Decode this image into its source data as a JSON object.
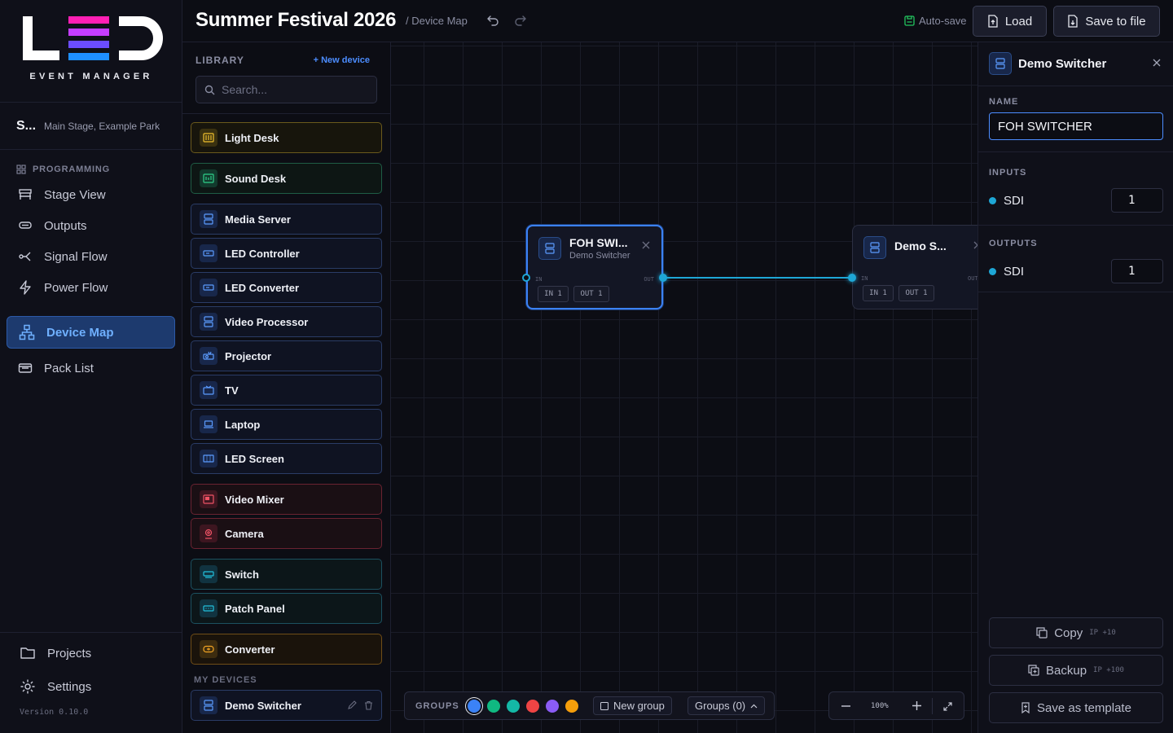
{
  "brand": {
    "logo_text": "LED",
    "subtitle": "EVENT MANAGER"
  },
  "project": {
    "name": "S...",
    "location": "Main Stage, Example Park"
  },
  "sidebar": {
    "section_label": "PROGRAMMING",
    "items": [
      {
        "label": "Stage View",
        "icon": "stage-icon"
      },
      {
        "label": "Outputs",
        "icon": "outputs-icon"
      },
      {
        "label": "Signal Flow",
        "icon": "signal-flow-icon"
      },
      {
        "label": "Power Flow",
        "icon": "power-icon"
      },
      {
        "label": "Device Map",
        "icon": "device-map-icon",
        "active": true
      },
      {
        "label": "Pack List",
        "icon": "pack-list-icon"
      }
    ],
    "footer": [
      {
        "label": "Projects",
        "icon": "folder-icon"
      },
      {
        "label": "Settings",
        "icon": "gear-icon"
      }
    ],
    "version": "Version 0.10.0"
  },
  "header": {
    "title": "Summer Festival 2026",
    "breadcrumb": "/ Device Map",
    "autosave": "Auto-save",
    "load_label": "Load",
    "save_label": "Save to file"
  },
  "library": {
    "heading": "LIBRARY",
    "new_device": "New device",
    "search_placeholder": "Search...",
    "devices": [
      {
        "label": "Light Desk",
        "color": "yellow"
      },
      {
        "label": "Sound Desk",
        "color": "green"
      },
      {
        "label": "Media Server",
        "color": "blue"
      },
      {
        "label": "LED Controller",
        "color": "blue"
      },
      {
        "label": "LED Converter",
        "color": "blue"
      },
      {
        "label": "Video Processor",
        "color": "blue"
      },
      {
        "label": "Projector",
        "color": "blue"
      },
      {
        "label": "TV",
        "color": "blue"
      },
      {
        "label": "Laptop",
        "color": "blue"
      },
      {
        "label": "LED Screen",
        "color": "blue"
      },
      {
        "label": "Video Mixer",
        "color": "red"
      },
      {
        "label": "Camera",
        "color": "red"
      },
      {
        "label": "Switch",
        "color": "teal"
      },
      {
        "label": "Patch Panel",
        "color": "teal"
      },
      {
        "label": "Converter",
        "color": "orange"
      }
    ],
    "my_devices_label": "MY DEVICES",
    "my_devices": [
      {
        "label": "Demo Switcher",
        "color": "blue"
      }
    ]
  },
  "canvas": {
    "nodes": [
      {
        "title": "FOH SWI...",
        "subtitle": "Demo Switcher",
        "in_label": "IN",
        "out_label": "OUT",
        "in_pill": "IN 1",
        "out_pill": "OUT 1",
        "selected": true
      },
      {
        "title": "Demo S...",
        "subtitle": "",
        "in_label": "IN",
        "out_label": "OUT",
        "in_pill": "IN 1",
        "out_pill": "OUT 1",
        "selected": false
      }
    ],
    "groups": {
      "label": "GROUPS",
      "swatches": [
        "#3b82f6",
        "#10b981",
        "#14b8a6",
        "#ef4444",
        "#8b5cf6",
        "#f59e0b"
      ],
      "new_group": "New group",
      "groups_count": "Groups (0)"
    },
    "zoom": {
      "level": "100%"
    }
  },
  "panel": {
    "title": "Demo Switcher",
    "name_label": "NAME",
    "name_value": "FOH SWITCHER",
    "inputs_label": "INPUTS",
    "inputs": [
      {
        "name": "SDI",
        "count": "1"
      }
    ],
    "outputs_label": "OUTPUTS",
    "outputs": [
      {
        "name": "SDI",
        "count": "1"
      }
    ],
    "actions": [
      {
        "label": "Copy",
        "hint": "IP +10"
      },
      {
        "label": "Backup",
        "hint": "IP +100"
      },
      {
        "label": "Save as template",
        "hint": ""
      }
    ]
  },
  "colors": {
    "accent": "#4c8dff",
    "wire": "#1ea7d6",
    "active_nav_bg": "#1d3a6e"
  }
}
